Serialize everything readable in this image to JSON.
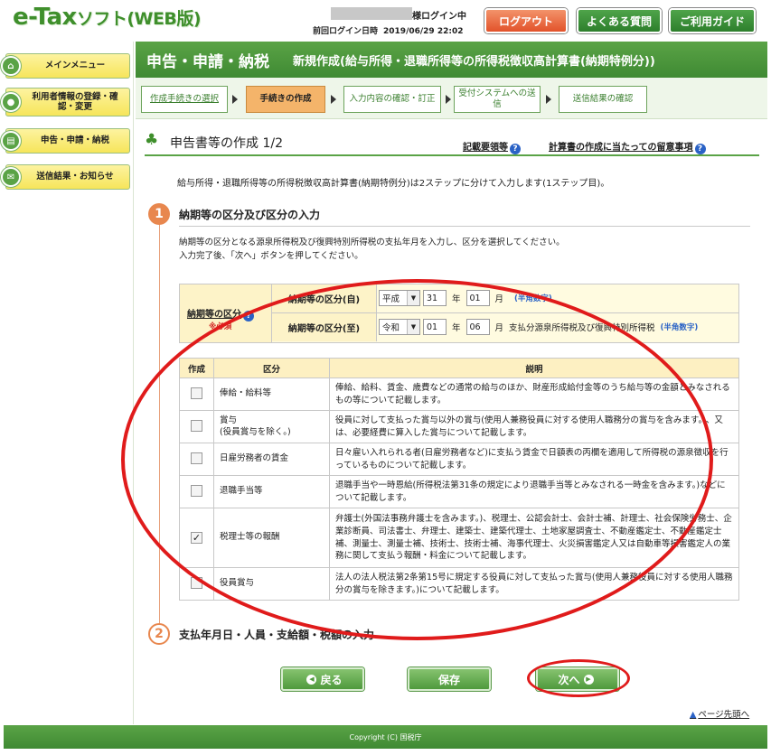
{
  "header": {
    "logo_main": "e-Tax",
    "logo_sub": "ソフト(WEB版)",
    "login_status": "様ログイン中",
    "last_login_label": "前回ログイン日時",
    "last_login_value": "2019/06/29 22:02",
    "logout_label": "ログアウト",
    "faq_label": "よくある質問",
    "guide_label": "ご利用ガイド"
  },
  "sidebar": {
    "items": [
      {
        "label": "メインメニュー"
      },
      {
        "label": "利用者情報の登録・確認・変更"
      },
      {
        "label": "申告・申請・納税"
      },
      {
        "label": "送信結果・お知らせ"
      }
    ]
  },
  "main": {
    "title": "申告・申請・納税",
    "subtitle": "新規作成(給与所得・退職所得等の所得税徴収高計算書(納期特例分))"
  },
  "steps": [
    {
      "label": "作成手続きの選択"
    },
    {
      "label": "手続きの作成"
    },
    {
      "label": "入力内容の確認・訂正"
    },
    {
      "label": "受付システムへの送信"
    },
    {
      "label": "送信結果の確認"
    }
  ],
  "section": {
    "title": "申告書等の作成 1/2",
    "link1": "記載要領等",
    "link2": "計算書の作成に当たっての留意事項"
  },
  "intro": "給与所得・退職所得等の所得税徴収高計算書(納期特例分)は2ステップに分けて入力します(1ステップ目)。",
  "step1": {
    "number": "1",
    "heading": "納期等の区分及び区分の入力",
    "instr1": "納期等の区分となる源泉所得税及び復興特別所得税の支払年月を入力し、区分を選択してください。",
    "instr2": "入力完了後、「次へ」ボタンを押してください。"
  },
  "period": {
    "label": "納期等の区分",
    "required": "※必須",
    "from": {
      "label": "納期等の区分(自)",
      "era": "平成",
      "year": "31",
      "month": "01"
    },
    "to": {
      "label": "納期等の区分(至)",
      "era": "令和",
      "year": "01",
      "month": "06"
    },
    "year_unit": "年",
    "month_unit": "月",
    "half_width_hint": "(半角数字)",
    "to_note": "支払分源泉所得税及び復興特別所得税"
  },
  "category_table": {
    "headers": [
      "作成",
      "区分",
      "説明"
    ],
    "rows": [
      {
        "checked": false,
        "category": "俸給・給料等",
        "category_sub": "",
        "description": "俸給、給料、賃金、歳費などの通常の給与のほか、財産形成給付金等のうち給与等の金額とみなされるもの等について記載します。"
      },
      {
        "checked": false,
        "category": "賞与",
        "category_sub": "(役員賞与を除く。)",
        "description": "役員に対して支払った賞与以外の賞与(使用人兼務役員に対する使用人職務分の賞与を含みます。)、又は、必要経費に算入した賞与について記載します。"
      },
      {
        "checked": false,
        "category": "日雇労務者の賃金",
        "category_sub": "",
        "description": "日々雇い入れられる者(日雇労務者など)に支払う賃金で日額表の丙欄を適用して所得税の源泉徴収を行っているものについて記載します。"
      },
      {
        "checked": false,
        "category": "退職手当等",
        "category_sub": "",
        "description": "退職手当や一時恩給(所得税法第31条の規定により退職手当等とみなされる一時金を含みます。)などについて記載します。"
      },
      {
        "checked": true,
        "category": "税理士等の報酬",
        "category_sub": "",
        "description": "弁護士(外国法事務弁護士を含みます。)、税理士、公認会計士、会計士補、計理士、社会保険労務士、企業診断員、司法書士、弁理士、建築士、建築代理士、土地家屋調査士、不動産鑑定士、不動産鑑定士補、測量士、測量士補、技術士、技術士補、海事代理士、火災損害鑑定人又は自動車等損害鑑定人の業務に関して支払う報酬・料金について記載します。"
      },
      {
        "checked": false,
        "category": "役員賞与",
        "category_sub": "",
        "description": "法人の法人税法第2条第15号に規定する役員に対して支払った賞与(使用人兼務役員に対する使用人職務分の賞与を除きます。)について記載します。"
      }
    ]
  },
  "step2": {
    "number": "2",
    "heading": "支払年月日・人員・支給額・税額の入力"
  },
  "buttons": {
    "back": "戻る",
    "save": "保存",
    "next": "次へ"
  },
  "page_top": "ページ先頭へ",
  "footer": "Copyright (C) 国税庁",
  "colors": {
    "brand_green": "#3f8a33",
    "highlight_red": "#e01b1b",
    "step_orange": "#e8874e"
  }
}
